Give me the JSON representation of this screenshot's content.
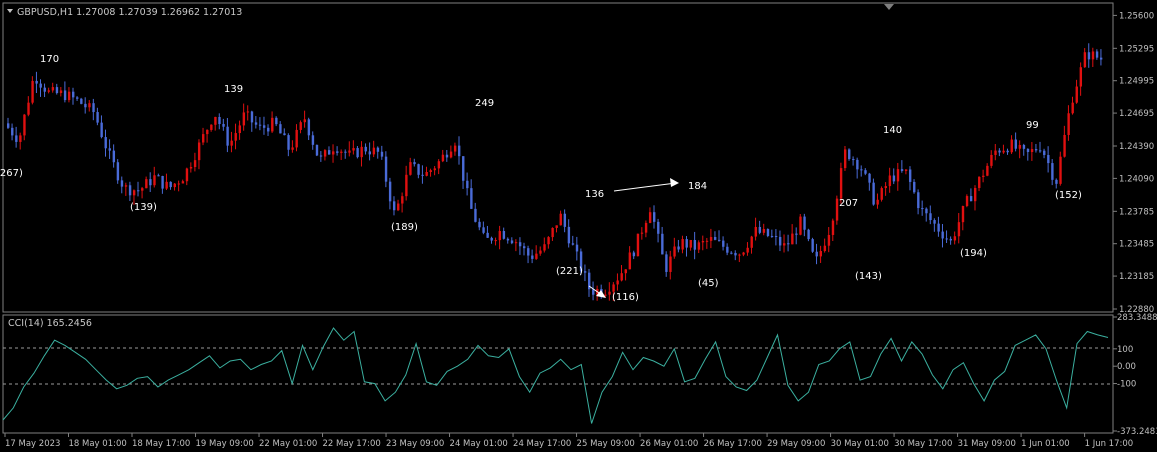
{
  "window": {
    "header": "GBPUSD,H1  1.27008 1.27039 1.26962 1.27013",
    "indicator_header": "CCI(14) 165.2456"
  },
  "colors": {
    "background": "#000000",
    "grid": "#7f7f7f",
    "bull_candle": "#e01010",
    "bear_candle": "#4a6bd8",
    "cci_line": "#3bb0a0",
    "text": "#ffffff",
    "axis_text": "#c0c0c0"
  },
  "icons": {
    "header_marker": "triangle-down-icon",
    "shift_marker": "triangle-down-icon"
  },
  "chart_data": [
    {
      "type": "candlestick",
      "title": "GBPUSD,H1",
      "ylim": [
        1.2288,
        1.2565
      ],
      "y_ticks": [
        "1.25600",
        "1.25295",
        "1.24995",
        "1.24695",
        "1.24390",
        "1.24090",
        "1.23785",
        "1.23485",
        "1.23185",
        "1.22880"
      ],
      "x_tick_labels": [
        "17 May 2023",
        "18 May 01:00",
        "18 May 17:00",
        "19 May 09:00",
        "22 May 01:00",
        "22 May 17:00",
        "23 May 09:00",
        "24 May 01:00",
        "24 May 17:00",
        "25 May 09:00",
        "26 May 01:00",
        "26 May 17:00",
        "29 May 09:00",
        "30 May 01:00",
        "30 May 17:00",
        "31 May 09:00",
        "1 Jun 01:00",
        "1 Jun 17:00"
      ],
      "price_path": [
        1.246,
        1.2445,
        1.2505,
        1.2488,
        1.2487,
        1.248,
        1.247,
        1.243,
        1.24,
        1.2398,
        1.241,
        1.24,
        1.2412,
        1.244,
        1.247,
        1.244,
        1.2468,
        1.2455,
        1.246,
        1.2435,
        1.2465,
        1.2425,
        1.244,
        1.243,
        1.2437,
        1.2432,
        1.2374,
        1.242,
        1.2412,
        1.2425,
        1.2445,
        1.2383,
        1.235,
        1.236,
        1.2352,
        1.2336,
        1.2345,
        1.2375,
        1.234,
        1.2305,
        1.2306,
        1.232,
        1.2345,
        1.2383,
        1.2325,
        1.235,
        1.2345,
        1.2352,
        1.2345,
        1.234,
        1.236,
        1.2355,
        1.2345,
        1.2368,
        1.233,
        1.2365,
        1.2435,
        1.242,
        1.2385,
        1.241,
        1.2415,
        1.238,
        1.2365,
        1.235,
        1.2385,
        1.241,
        1.2435,
        1.244,
        1.243,
        1.244,
        1.2405,
        1.248,
        1.2525,
        1.252
      ],
      "annotations": [
        {
          "text": "(267)"
        },
        {
          "text": "170"
        },
        {
          "text": "(139)"
        },
        {
          "text": "139"
        },
        {
          "text": "(189)"
        },
        {
          "text": "249"
        },
        {
          "text": "(221)"
        },
        {
          "text": "136"
        },
        {
          "text": "(116)"
        },
        {
          "text": "184"
        },
        {
          "text": "(45)"
        },
        {
          "text": "207"
        },
        {
          "text": "(143)"
        },
        {
          "text": "140"
        },
        {
          "text": "(194)"
        },
        {
          "text": "99"
        },
        {
          "text": "(152)"
        }
      ]
    },
    {
      "type": "line",
      "title": "CCI(14) 165.2456",
      "ylim": [
        -373.2483,
        283.3488
      ],
      "y_ticks": [
        "283.3488",
        "100",
        "0.00",
        "-100",
        "-373.2483"
      ],
      "levels": [
        100,
        -100
      ],
      "series": [
        {
          "values": [
            -310,
            -240,
            -120,
            -40,
            60,
            150,
            120,
            80,
            40,
            -20,
            -80,
            -130,
            -110,
            -70,
            -60,
            -120,
            -80,
            -50,
            -20,
            20,
            60,
            -10,
            30,
            40,
            -20,
            10,
            30,
            90,
            -100,
            120,
            -20,
            110,
            220,
            150,
            200,
            -90,
            -100,
            -200,
            -150,
            -50,
            130,
            -90,
            -110,
            -30,
            0,
            40,
            120,
            60,
            50,
            100,
            -60,
            -150,
            -40,
            -10,
            40,
            -20,
            10,
            -330,
            -150,
            -60,
            80,
            -20,
            50,
            30,
            0,
            100,
            -90,
            -70,
            40,
            140,
            -60,
            -120,
            -140,
            -80,
            50,
            180,
            -110,
            -200,
            -150,
            10,
            30,
            100,
            140,
            -80,
            -60,
            70,
            160,
            30,
            140,
            70,
            -50,
            -130,
            -20,
            20,
            -100,
            -200,
            -80,
            -30,
            120,
            150,
            180,
            100,
            -80,
            -240,
            130,
            200,
            180,
            165
          ]
        }
      ]
    }
  ]
}
